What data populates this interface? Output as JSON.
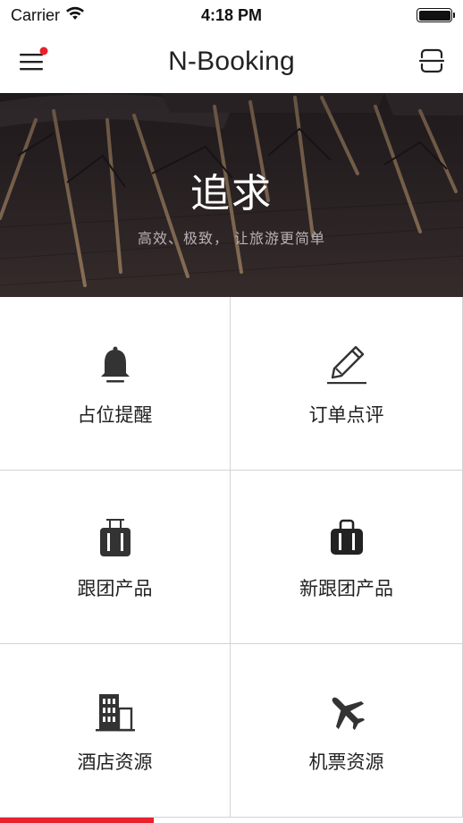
{
  "status_bar": {
    "carrier": "Carrier",
    "time": "4:18 PM"
  },
  "nav": {
    "title": "N-Booking",
    "menu_icon": "hamburger-menu-icon",
    "scan_icon": "scan-icon",
    "notification_dot_color": "#e8212c"
  },
  "hero": {
    "title": "追求",
    "subtitle": "高效、极致， 让旅游更简单"
  },
  "grid": {
    "items": [
      {
        "label": "占位提醒",
        "icon": "bell-icon"
      },
      {
        "label": "订单点评",
        "icon": "pencil-icon"
      },
      {
        "label": "跟团产品",
        "icon": "luggage-icon"
      },
      {
        "label": "新跟团产品",
        "icon": "bag-icon"
      },
      {
        "label": "酒店资源",
        "icon": "building-icon"
      },
      {
        "label": "机票资源",
        "icon": "airplane-icon"
      }
    ]
  },
  "colors": {
    "accent": "#e8212c",
    "icon": "#333333",
    "divider": "#d3d3d3"
  }
}
